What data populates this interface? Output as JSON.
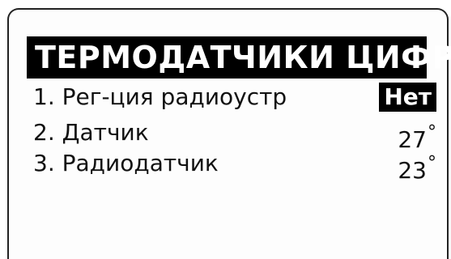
{
  "screen": {
    "title": "ТЕРМОДАТЧИКИ ЦИФР",
    "items": [
      {
        "label": "1. Рег-ция радиоустр",
        "value": "Нет",
        "selected": true
      },
      {
        "label": "2. Датчик",
        "value": "27",
        "unit": "°"
      },
      {
        "label": "3. Радиодатчик",
        "value": "23",
        "unit": "°"
      }
    ]
  }
}
